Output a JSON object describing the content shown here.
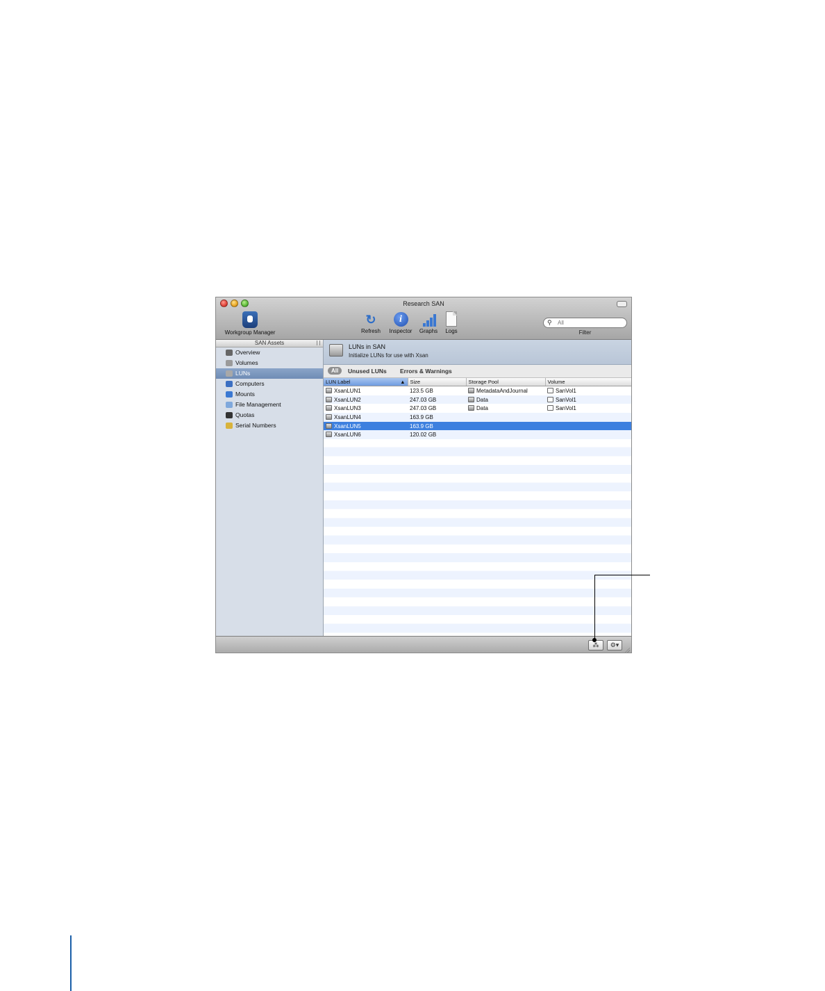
{
  "window": {
    "title": "Research SAN"
  },
  "toolbar": {
    "workgroup_manager": "Workgroup Manager",
    "refresh": "Refresh",
    "inspector": "Inspector",
    "graphs": "Graphs",
    "logs": "Logs",
    "filter_placeholder": "All",
    "filter_label": "Filter"
  },
  "sidebar": {
    "header": "SAN Assets",
    "items": [
      {
        "label": "Overview",
        "icon": "overview-icon",
        "color": "#666666"
      },
      {
        "label": "Volumes",
        "icon": "volume-icon",
        "color": "#9a9a9a"
      },
      {
        "label": "LUNs",
        "icon": "lun-icon",
        "color": "#a8a8a8"
      },
      {
        "label": "Computers",
        "icon": "computer-icon",
        "color": "#3b6fc2"
      },
      {
        "label": "Mounts",
        "icon": "mount-icon",
        "color": "#3a78d2"
      },
      {
        "label": "File Management",
        "icon": "folder-icon",
        "color": "#7fa8dc"
      },
      {
        "label": "Quotas",
        "icon": "person-icon",
        "color": "#333333"
      },
      {
        "label": "Serial Numbers",
        "icon": "serial-icon",
        "color": "#d8b33c"
      }
    ],
    "selected": "LUNs"
  },
  "main": {
    "heading": "LUNs in SAN",
    "subheading": "Initialize LUNs for use with Xsan",
    "scope": [
      "All",
      "Unused LUNs",
      "Errors & Warnings"
    ],
    "columns": [
      "LUN Label",
      "Size",
      "Storage Pool",
      "Volume"
    ],
    "rows": [
      {
        "label": "XsanLUN1",
        "size": "123.5 GB",
        "pool": "MetadataAndJournal",
        "volume": "SanVol1"
      },
      {
        "label": "XsanLUN2",
        "size": "247.03 GB",
        "pool": "Data",
        "volume": "SanVol1"
      },
      {
        "label": "XsanLUN3",
        "size": "247.03 GB",
        "pool": "Data",
        "volume": "SanVol1"
      },
      {
        "label": "XsanLUN4",
        "size": "163.9 GB",
        "pool": "",
        "volume": ""
      },
      {
        "label": "XsanLUN5",
        "size": "163.9 GB",
        "pool": "",
        "volume": ""
      },
      {
        "label": "XsanLUN6",
        "size": "120.02 GB",
        "pool": "",
        "volume": ""
      }
    ],
    "selected_row": "XsanLUN5"
  },
  "bottom": {
    "button1_icon": "label-lun-icon",
    "button2_icon": "action-gear-icon"
  },
  "colors": {
    "selection": "#3d80df",
    "sidebar_bg": "#d7dee8",
    "sidebar_selection": "#7b97bf"
  }
}
